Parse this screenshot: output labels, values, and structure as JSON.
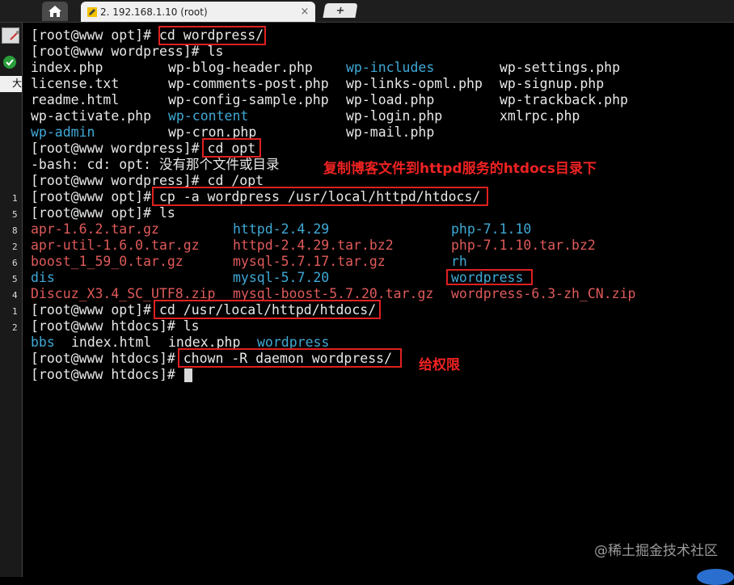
{
  "tabbar": {
    "tab_label": "2. 192.168.1.10 (root)",
    "close_glyph": "×",
    "newtab_glyph": "+"
  },
  "left_panel": {
    "numbers": [
      "1",
      "5",
      "8",
      "2",
      "6",
      "5",
      "4",
      "1",
      "2"
    ],
    "partial_char": "大"
  },
  "terminal": {
    "lines": [
      {
        "prompt": "[root@www opt]# ",
        "cmd": "cd wordpress/"
      },
      {
        "prompt": "[root@www wordpress]# ",
        "cmd": "ls"
      },
      {
        "prompt": "[root@www wordpress]# ",
        "cmd": "cd opt"
      },
      {
        "text": "-bash: cd: opt: 没有那个文件或目录"
      },
      {
        "prompt": "[root@www wordpress]# ",
        "cmd": "cd /opt"
      },
      {
        "prompt": "[root@www opt]# ",
        "cmd": "cp -a wordpress /usr/local/httpd/htdocs/"
      },
      {
        "prompt": "[root@www opt]# ",
        "cmd": "ls"
      },
      {
        "prompt": "[root@www opt]# ",
        "cmd": "cd /usr/local/httpd/htdocs/"
      },
      {
        "prompt": "[root@www htdocs]# ",
        "cmd": "ls"
      },
      {
        "prompt": "[root@www htdocs]# ",
        "cmd": "chown -R daemon wordpress/"
      },
      {
        "prompt": "[root@www htdocs]# ",
        "cmd": ""
      }
    ],
    "ls_wordpress": [
      [
        "index.php",
        "wp-blog-header.php",
        "wp-includes",
        "wp-settings.php"
      ],
      [
        "license.txt",
        "wp-comments-post.php",
        "wp-links-opml.php",
        "wp-signup.php"
      ],
      [
        "readme.html",
        "wp-config-sample.php",
        "wp-load.php",
        "wp-trackback.php"
      ],
      [
        "wp-activate.php",
        "wp-content",
        "wp-login.php",
        "xmlrpc.php"
      ],
      [
        "wp-admin",
        "wp-cron.php",
        "wp-mail.php",
        ""
      ]
    ],
    "ls_opt": [
      [
        "apr-1.6.2.tar.gz",
        "httpd-2.4.29",
        "php-7.1.10"
      ],
      [
        "apr-util-1.6.0.tar.gz",
        "httpd-2.4.29.tar.bz2",
        "php-7.1.10.tar.bz2"
      ],
      [
        "boost_1_59_0.tar.gz",
        "mysql-5.7.17.tar.gz",
        "rh"
      ],
      [
        "dis",
        "mysql-5.7.20",
        "wordpress"
      ],
      [
        "Discuz_X3.4_SC_UTF8.zip",
        "mysql-boost-5.7.20.tar.gz",
        "wordpress-6.3-zh_CN.zip"
      ]
    ],
    "ls_htdocs": [
      "bbs",
      "index.html",
      "index.php",
      "wordpress"
    ]
  },
  "annotations": {
    "copy_note": "复制博客文件到httpd服务的htdocs目录下",
    "perm_note": "给权限"
  },
  "watermark": "@稀土掘金技术社区",
  "colors": {
    "background": "#000000",
    "text": "#e8e8e8",
    "directory": "#3fa9d6",
    "archive": "#e05a5a",
    "highlight_box": "#e02020",
    "annotation": "#ee2222"
  }
}
